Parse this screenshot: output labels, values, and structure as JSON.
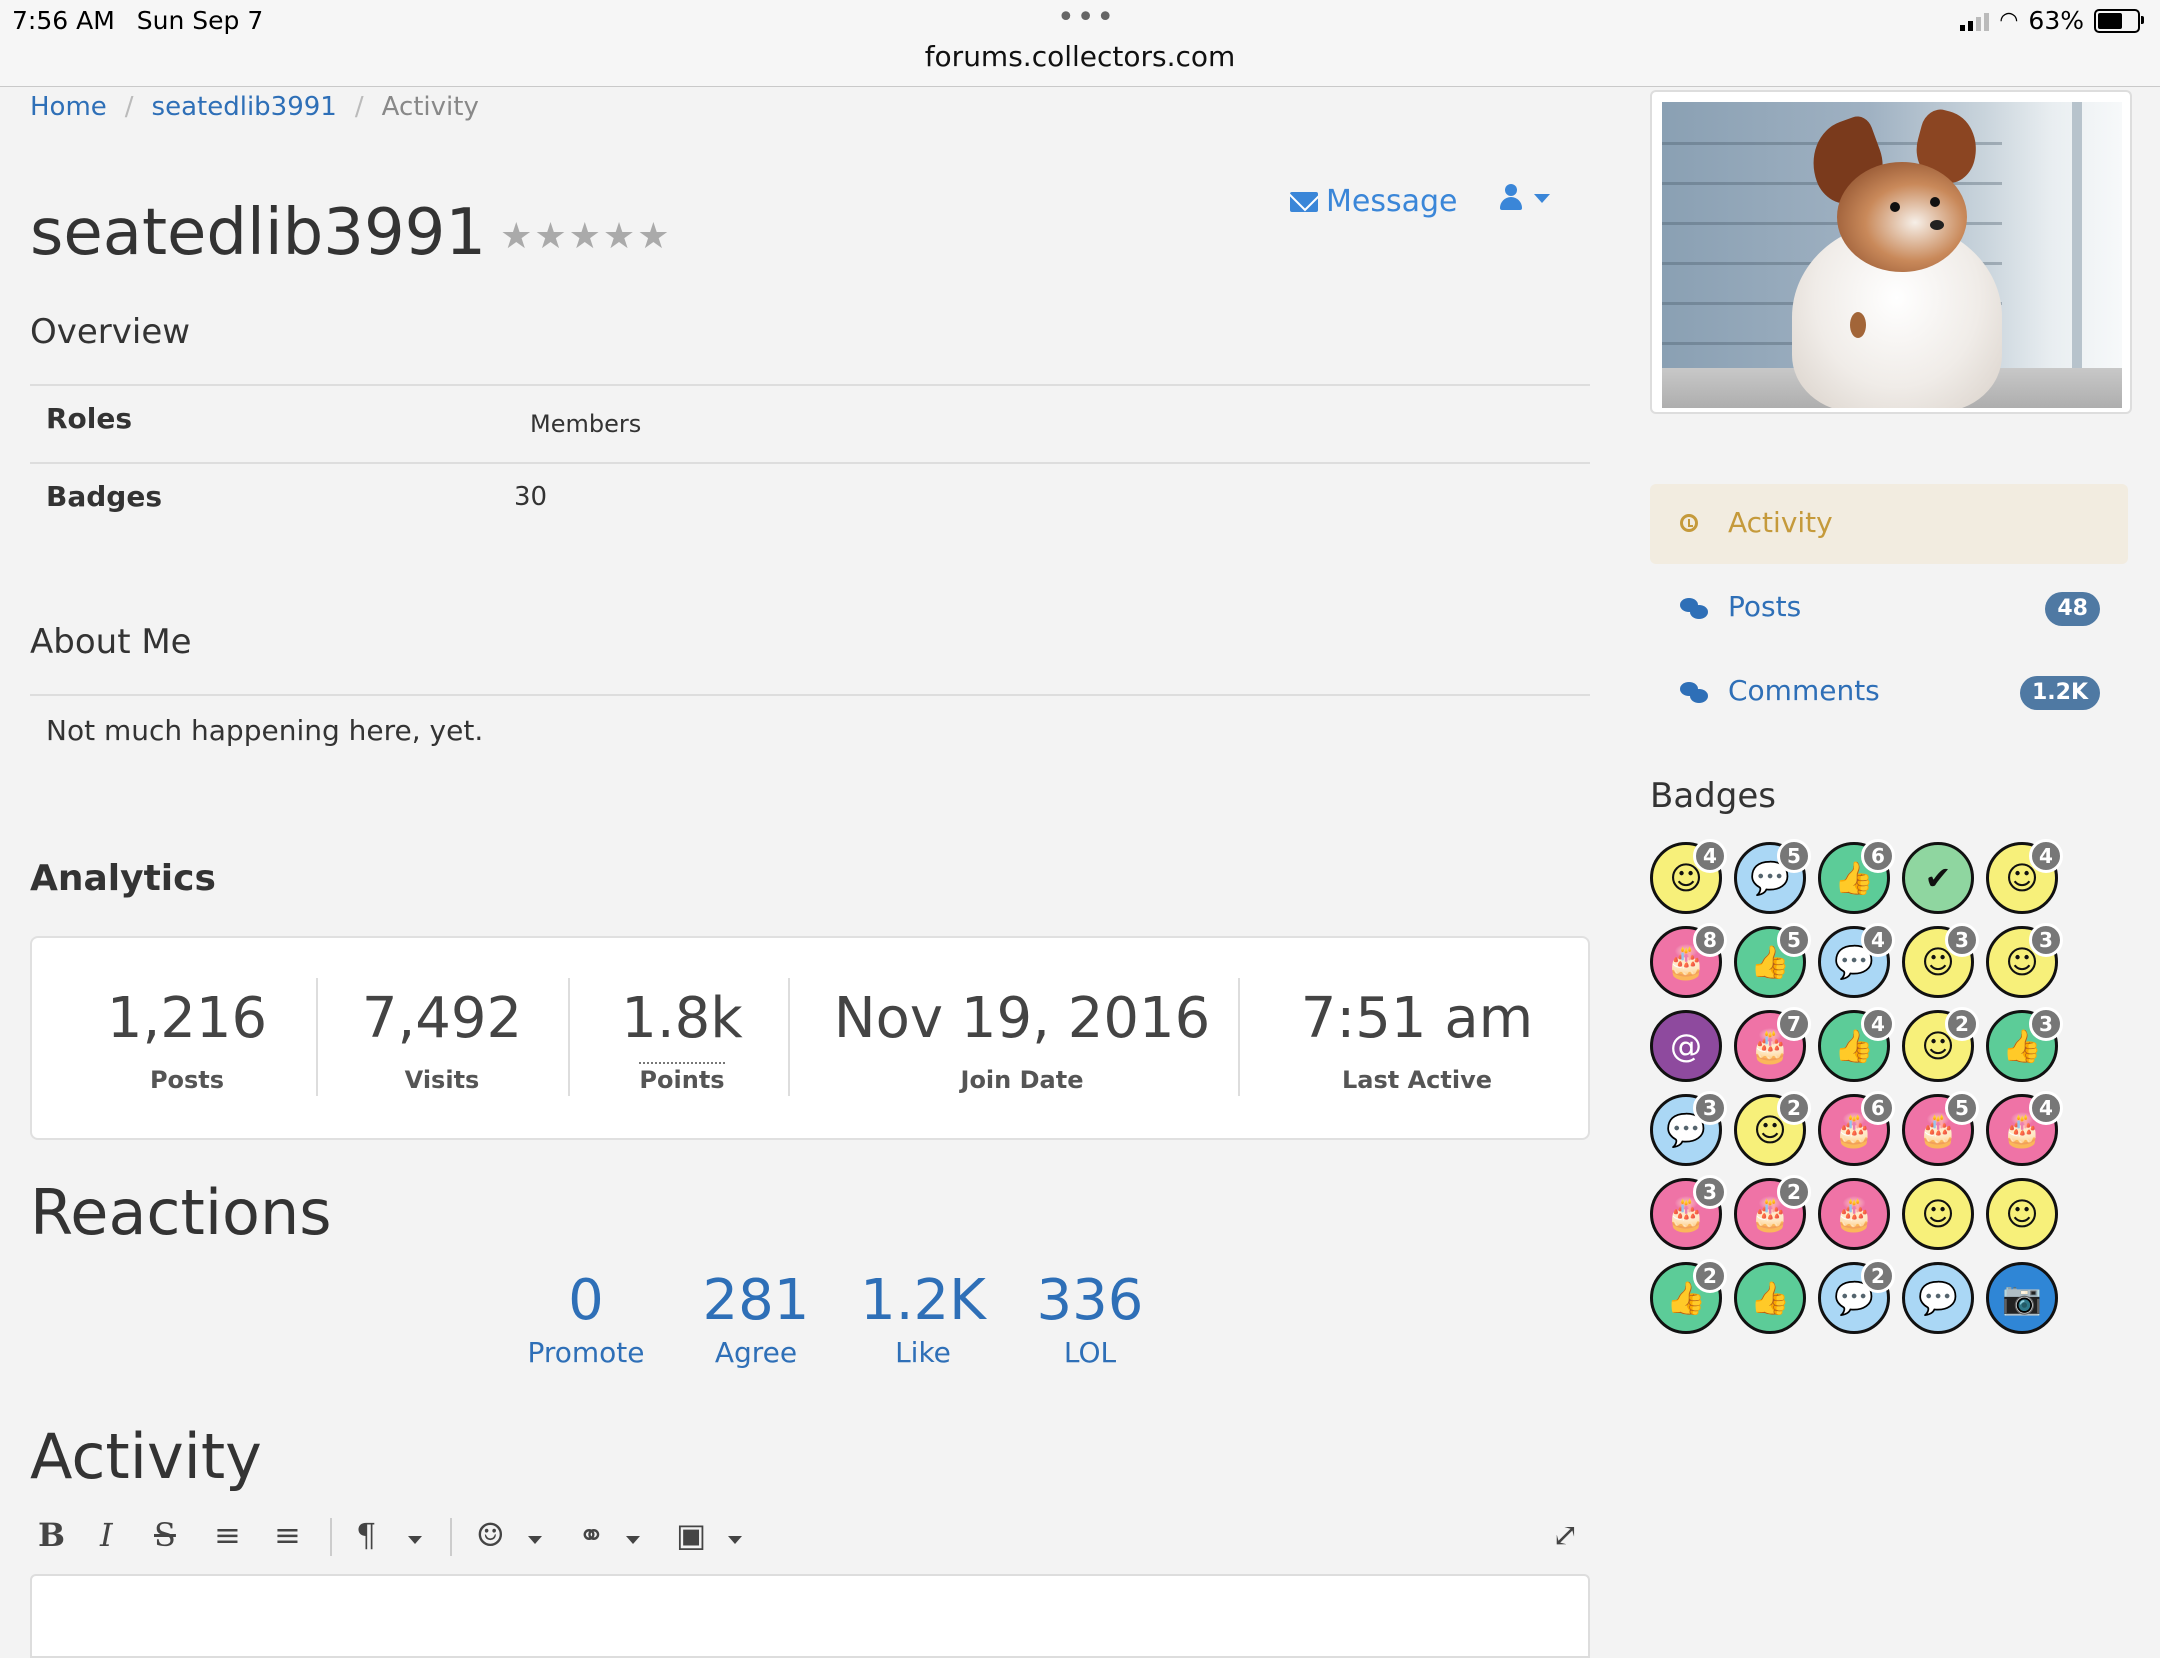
{
  "status": {
    "time": "7:56 AM",
    "date": "Sun Sep 7",
    "url": "forums.collectors.com",
    "battery": "63%"
  },
  "breadcrumb": {
    "home": "Home",
    "user": "seatedlib3991",
    "current": "Activity"
  },
  "profile": {
    "username": "seatedlib3991",
    "stars": "★★★★★",
    "message_label": "Message"
  },
  "overview": {
    "heading": "Overview",
    "rows": [
      {
        "label": "Roles",
        "value": "Members"
      },
      {
        "label": "Badges",
        "value": "30"
      }
    ]
  },
  "about": {
    "heading": "About Me",
    "text": "Not much happening here, yet."
  },
  "analytics": {
    "heading": "Analytics",
    "stats": [
      {
        "value": "1,216",
        "label": "Posts"
      },
      {
        "value": "7,492",
        "label": "Visits"
      },
      {
        "value": "1.8k",
        "label": "Points"
      },
      {
        "value": "Nov 19, 2016",
        "label": "Join Date"
      },
      {
        "value": "7:51 am",
        "label": "Last Active"
      }
    ]
  },
  "reactions": {
    "heading": "Reactions",
    "items": [
      {
        "value": "0",
        "label": "Promote"
      },
      {
        "value": "281",
        "label": "Agree"
      },
      {
        "value": "1.2K",
        "label": "Like"
      },
      {
        "value": "336",
        "label": "LOL"
      }
    ]
  },
  "activity": {
    "heading": "Activity"
  },
  "toolbar": {
    "bold": "B",
    "italic": "I",
    "strike": "S",
    "ordered": "≡",
    "bullets": "≡",
    "paragraph": "¶",
    "emoji": "☺",
    "link": "⚭",
    "image": "▣",
    "expand": "⤢"
  },
  "sidebar": {
    "nav": [
      {
        "label": "Activity",
        "count": ""
      },
      {
        "label": "Posts",
        "count": "48"
      },
      {
        "label": "Comments",
        "count": "1.2K"
      }
    ],
    "badges_heading": "Badges",
    "badges": [
      {
        "icon": "smile-icon",
        "glyph": "☺",
        "color": "#f7f07a",
        "count": "4"
      },
      {
        "icon": "comment-icon",
        "glyph": "💬",
        "color": "#aad7f5",
        "count": "5"
      },
      {
        "icon": "thumbs-up-icon",
        "glyph": "👍",
        "color": "#5ccc98",
        "count": "6"
      },
      {
        "icon": "check-icon",
        "glyph": "✔",
        "color": "#8fd6a0",
        "count": ""
      },
      {
        "icon": "wink-icon",
        "glyph": "☺",
        "color": "#f7f07a",
        "count": "4"
      },
      {
        "icon": "cake-icon",
        "glyph": "🎂",
        "color": "#ef73a6",
        "count": "8"
      },
      {
        "icon": "thumbs-up-icon",
        "glyph": "👍",
        "color": "#5ccc98",
        "count": "5"
      },
      {
        "icon": "comment-icon",
        "glyph": "💬",
        "color": "#aad7f5",
        "count": "4"
      },
      {
        "icon": "smile-icon",
        "glyph": "☺",
        "color": "#f7f07a",
        "count": "3"
      },
      {
        "icon": "wink-icon",
        "glyph": "☺",
        "color": "#f7f07a",
        "count": "3"
      },
      {
        "icon": "address-book-icon",
        "glyph": "@",
        "color": "#8e4a9e",
        "count": ""
      },
      {
        "icon": "cake-icon",
        "glyph": "🎂",
        "color": "#ef73a6",
        "count": "7"
      },
      {
        "icon": "thumbs-up-icon",
        "glyph": "👍",
        "color": "#5ccc98",
        "count": "4"
      },
      {
        "icon": "smile-icon",
        "glyph": "☺",
        "color": "#f7f07a",
        "count": "2"
      },
      {
        "icon": "thumbs-up-icon",
        "glyph": "👍",
        "color": "#5ccc98",
        "count": "3"
      },
      {
        "icon": "comment-icon",
        "glyph": "💬",
        "color": "#aad7f5",
        "count": "3"
      },
      {
        "icon": "wink-icon",
        "glyph": "☺",
        "color": "#f7f07a",
        "count": "2"
      },
      {
        "icon": "cake-icon",
        "glyph": "🎂",
        "color": "#ef73a6",
        "count": "6"
      },
      {
        "icon": "cake-icon",
        "glyph": "🎂",
        "color": "#ef73a6",
        "count": "5"
      },
      {
        "icon": "cake-icon",
        "glyph": "🎂",
        "color": "#ef73a6",
        "count": "4"
      },
      {
        "icon": "cake-icon",
        "glyph": "🎂",
        "color": "#ef73a6",
        "count": "3"
      },
      {
        "icon": "cake-icon",
        "glyph": "🎂",
        "color": "#ef73a6",
        "count": "2"
      },
      {
        "icon": "cake-icon",
        "glyph": "🎂",
        "color": "#ef73a6",
        "count": ""
      },
      {
        "icon": "wink-icon",
        "glyph": "☺",
        "color": "#f7f07a",
        "count": ""
      },
      {
        "icon": "smile-icon",
        "glyph": "☺",
        "color": "#f7f07a",
        "count": ""
      },
      {
        "icon": "thumbs-up-icon",
        "glyph": "👍",
        "color": "#5ccc98",
        "count": "2"
      },
      {
        "icon": "thumbs-up-icon",
        "glyph": "👍",
        "color": "#5ccc98",
        "count": ""
      },
      {
        "icon": "comment-icon",
        "glyph": "💬",
        "color": "#aad7f5",
        "count": "2"
      },
      {
        "icon": "comment-icon",
        "glyph": "💬",
        "color": "#aad7f5",
        "count": ""
      },
      {
        "icon": "camera-icon",
        "glyph": "📷",
        "color": "#2f86d6",
        "count": ""
      }
    ]
  }
}
